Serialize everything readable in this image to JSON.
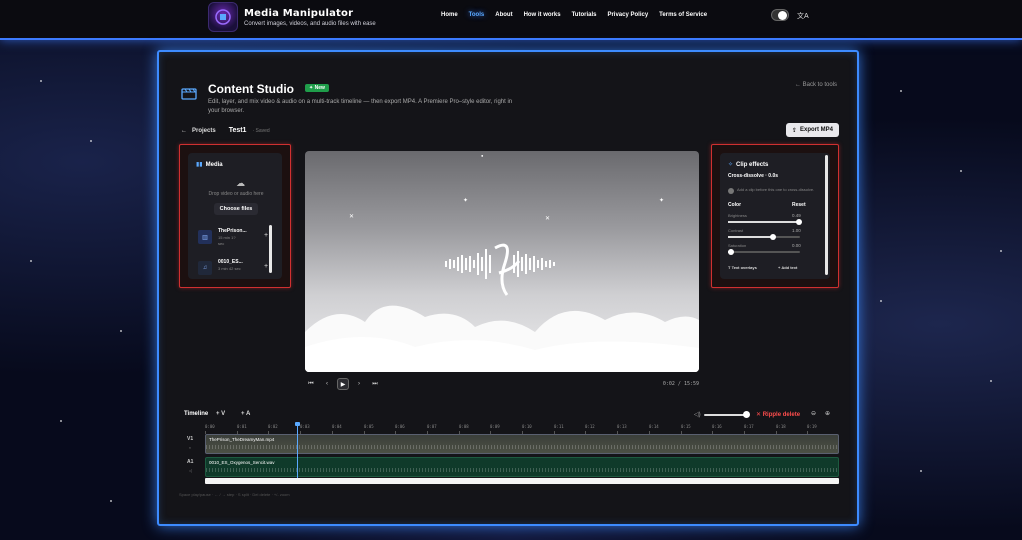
{
  "brand": {
    "title": "Media Manipulator",
    "subtitle": "Convert images, videos, and audio files with ease"
  },
  "nav": {
    "items": [
      {
        "label": "Home",
        "active": false
      },
      {
        "label": "Tools",
        "active": true
      },
      {
        "label": "About",
        "active": false
      },
      {
        "label": "How it works",
        "active": false
      },
      {
        "label": "Tutorials",
        "active": false
      },
      {
        "label": "Privacy Policy",
        "active": false
      },
      {
        "label": "Terms of Service",
        "active": false
      }
    ]
  },
  "studio": {
    "title": "Content Studio",
    "badge": "New",
    "description": "Edit, layer, and mix video & audio on a multi-track timeline — then export MP4. A Premiere Pro–style editor, right in your browser.",
    "back_label": "Back to tools"
  },
  "project": {
    "projects_label": "Projects",
    "name": "Test1",
    "status": "· Saved",
    "export_label": "Export MP4"
  },
  "media": {
    "title": "Media",
    "drop_text": "Drop video or audio here",
    "choose_label": "Choose files",
    "items": [
      {
        "name": "ThePrison...",
        "meta1": "15 min 1?",
        "meta2": "sec"
      },
      {
        "name": "0010_ES...",
        "meta1": "3 min 42 sec",
        "meta2": ""
      }
    ]
  },
  "effects": {
    "title": "Clip effects",
    "transition_label": "Cross-dissolve · 0.0s",
    "transition_hint": "Add a clip before this one to cross-dissolve.",
    "color_label": "Color",
    "reset_label": "Reset",
    "sliders": [
      {
        "label": "Brightness",
        "value": "0.49",
        "fraction": 0.98
      },
      {
        "label": "Contrast",
        "value": "1.00",
        "fraction": 0.62
      },
      {
        "label": "Saturation",
        "value": "0.00",
        "fraction": 0.04
      }
    ],
    "text_overlays_label": "Text overlays",
    "add_text_label": "Add text"
  },
  "player": {
    "timecode": "0:02 / 15:59"
  },
  "timeline": {
    "title": "Timeline",
    "add_video": "V",
    "add_audio": "A",
    "volume_fraction": 0.95,
    "ripple_label": "Ripple delete",
    "ticks": [
      "0:00",
      "0:01",
      "0:02",
      "0:03",
      "0:04",
      "0:05",
      "0:06",
      "0:07",
      "0:08",
      "0:09",
      "0:10",
      "0:11",
      "0:12",
      "0:13",
      "0:14",
      "0:15",
      "0:16",
      "0:17",
      "0:18",
      "0:19"
    ],
    "tracks": [
      {
        "label": "V1",
        "clip": "ThePrison_TheDreamyMan.mp4"
      },
      {
        "label": "A1",
        "clip": "0010_ES_Oxygenos_Sencit.wav"
      }
    ],
    "hint": "Space play/pause · ← / → step · S split · Del delete · +/- zoom"
  },
  "colors": {
    "accent": "#3d8bff",
    "danger": "#ff4d4d",
    "new_badge": "#1f9d4a"
  }
}
